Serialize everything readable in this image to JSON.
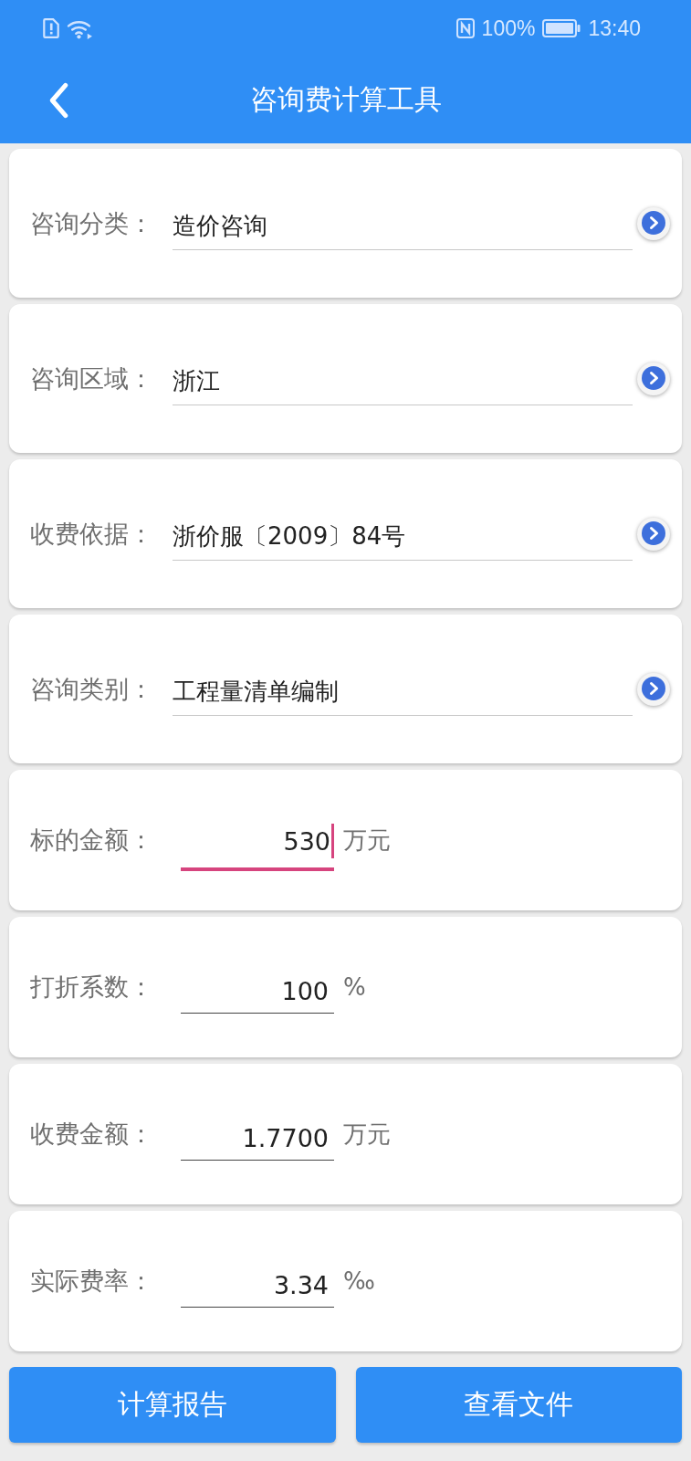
{
  "status_bar": {
    "battery": "100%",
    "time": "13:40"
  },
  "header": {
    "title": "咨询费计算工具"
  },
  "rows": [
    {
      "kind": "select",
      "label": "咨询分类：",
      "value": "造价咨询"
    },
    {
      "kind": "select",
      "label": "咨询区域：",
      "value": "浙江"
    },
    {
      "kind": "select",
      "label": "收费依据：",
      "value": "浙价服〔2009〕84号"
    },
    {
      "kind": "select",
      "label": "咨询类别：",
      "value": "工程量清单编制"
    },
    {
      "kind": "input",
      "label": "标的金额：",
      "value": "530",
      "unit": "万元",
      "focused": true
    },
    {
      "kind": "input",
      "label": "打折系数：",
      "value": "100",
      "unit": "%",
      "focused": false
    },
    {
      "kind": "input",
      "label": "收费金额：",
      "value": "1.7700",
      "unit": "万元",
      "focused": false
    },
    {
      "kind": "input",
      "label": "实际费率：",
      "value": "3.34",
      "unit": "‰",
      "focused": false
    }
  ],
  "buttons": [
    "计算报告",
    "查看文件"
  ]
}
